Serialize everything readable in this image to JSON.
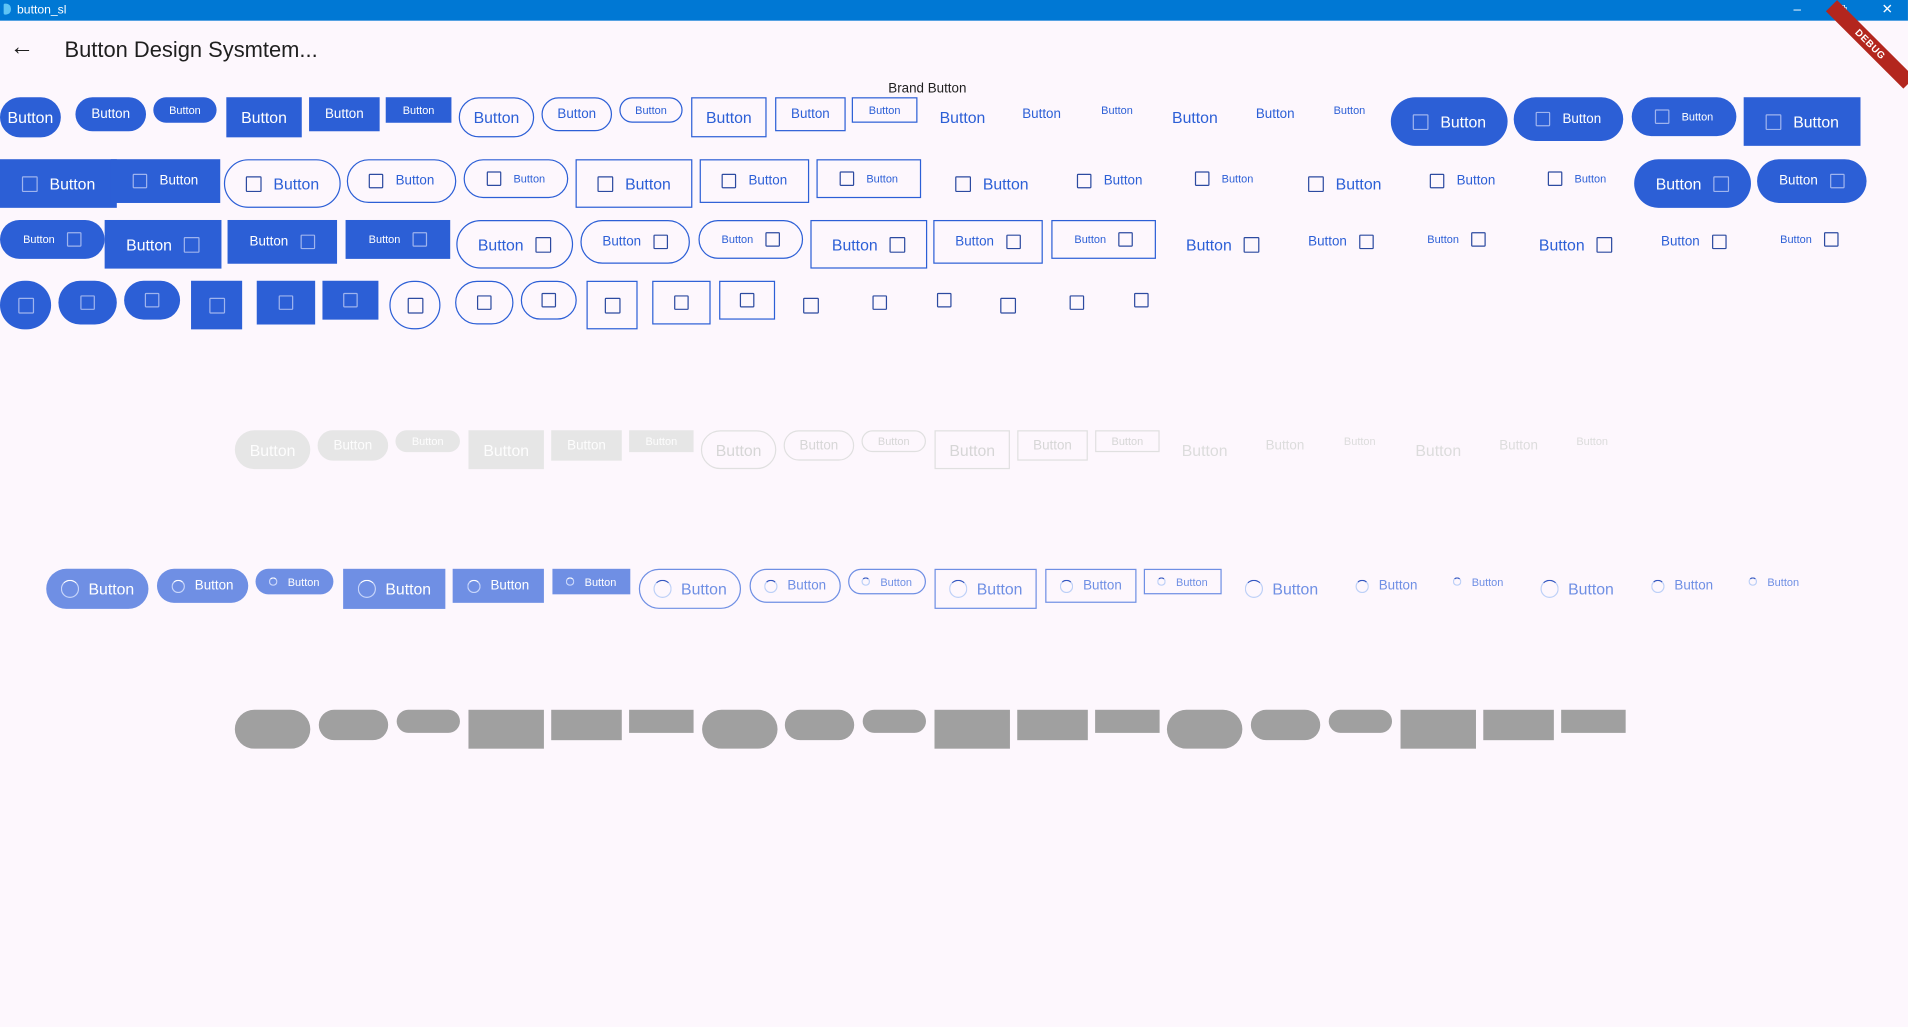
{
  "window": {
    "title": "button_sl",
    "minimize": "–",
    "restore": "⧉",
    "close": "✕"
  },
  "appbar": {
    "back_icon": "←",
    "title": "Button Design Sysmtem..."
  },
  "debug_banner": "DEBUG",
  "section": {
    "label": "Brand Button"
  },
  "button_label": "Button",
  "colors": {
    "brand": "#2c5fd6",
    "loading": "#6f8fe4",
    "disabled": "#e6e6e6",
    "skeleton": "#a0a0a0",
    "titlebar": "#0078d4",
    "background": "#fdf7fd"
  },
  "icons": {
    "checkbox": "checkbox-outline-icon",
    "spinner": "loading-spinner-icon",
    "back": "arrow-back-icon"
  }
}
